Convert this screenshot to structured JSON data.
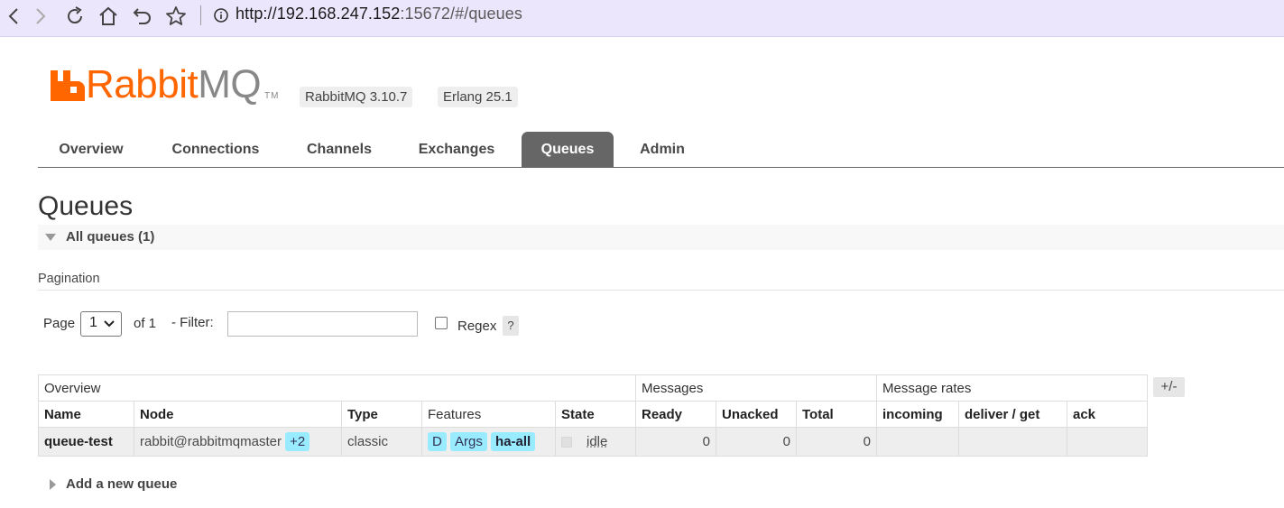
{
  "browser": {
    "url_host": "http://192.168.247.152",
    "url_rest": ":15672/#/queues"
  },
  "header": {
    "logo_text_a": "Rabbit",
    "logo_text_b": "MQ",
    "logo_tm": "TM",
    "version": "RabbitMQ 3.10.7",
    "erlang": "Erlang 25.1"
  },
  "tabs": [
    {
      "label": "Overview"
    },
    {
      "label": "Connections"
    },
    {
      "label": "Channels"
    },
    {
      "label": "Exchanges"
    },
    {
      "label": "Queues"
    },
    {
      "label": "Admin"
    }
  ],
  "page": {
    "title": "Queues",
    "section_label": "All queues (1)",
    "pagination_label": "Pagination",
    "page_label": "Page",
    "page_value": "1",
    "of_label": "of 1",
    "filter_label": "- Filter:",
    "filter_value": "",
    "regex_label": "Regex",
    "help_label": "?",
    "plusminus": "+/-",
    "add_queue_label": "Add a new queue"
  },
  "table": {
    "groups": [
      "Overview",
      "Messages",
      "Message rates"
    ],
    "columns": [
      "Name",
      "Node",
      "Type",
      "Features",
      "State",
      "Ready",
      "Unacked",
      "Total",
      "incoming",
      "deliver / get",
      "ack"
    ],
    "rows": [
      {
        "name": "queue-test",
        "node": "rabbit@rabbitmqmaster",
        "node_extra": "+2",
        "type": "classic",
        "features": [
          "D",
          "Args",
          "ha-all"
        ],
        "state": "idle",
        "ready": "0",
        "unacked": "0",
        "total": "0",
        "incoming": "",
        "deliver_get": "",
        "ack": ""
      }
    ]
  },
  "colors": {
    "accent": "#ff6600",
    "tab_active": "#666666",
    "pill": "#99ebff",
    "browser_bar": "#ebe6fb"
  }
}
